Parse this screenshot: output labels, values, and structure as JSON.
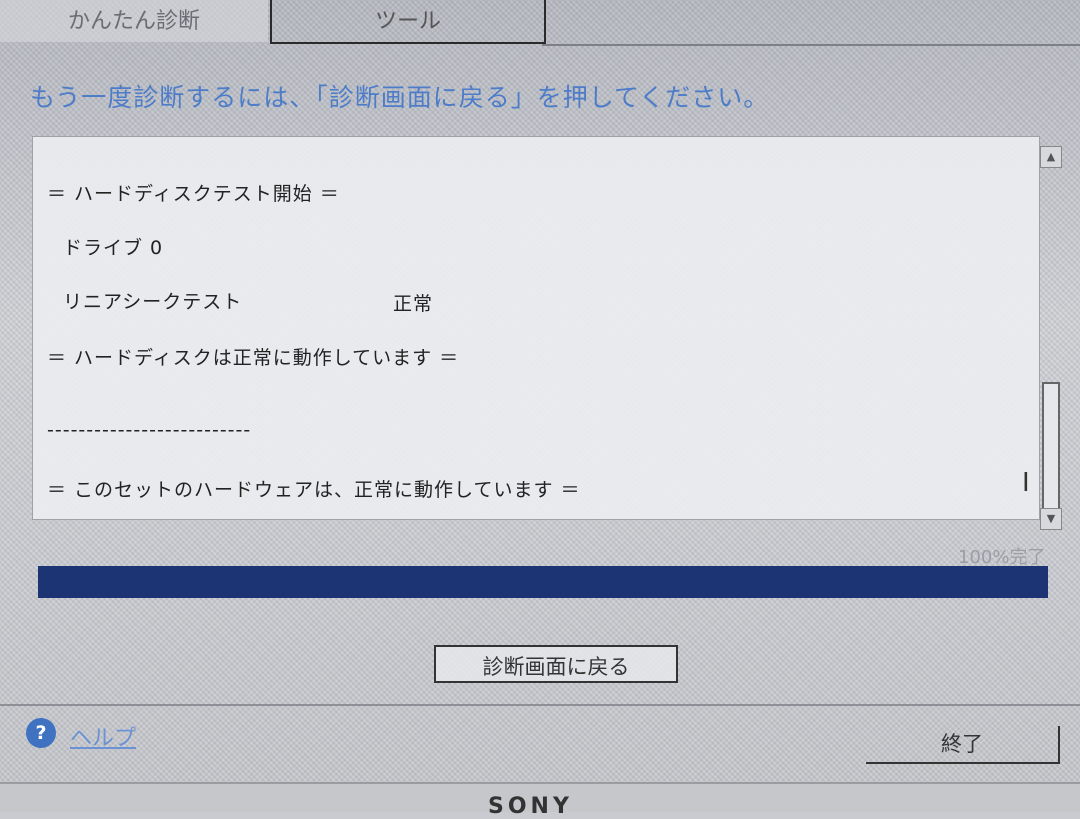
{
  "tabs": [
    {
      "label": "かんたん診断"
    },
    {
      "label": "ツール"
    }
  ],
  "instruction": "もう一度診断するには、「診断画面に戻る」を押してください。",
  "log": {
    "lines": [
      "＝ ハードディスクテスト開始 ＝",
      "ドライブ 0",
      "リニアシークテスト",
      "正常",
      "＝ ハードディスクは正常に動作しています ＝",
      "--------------------------",
      "＝ このセットのハードウェアは、正常に動作しています ＝"
    ]
  },
  "progress": {
    "label": "100%完了",
    "percent": 100,
    "color": "#1c3374"
  },
  "buttons": {
    "back": "診断画面に戻る",
    "exit": "終了"
  },
  "help": {
    "icon": "question-mark-icon",
    "icon_glyph": "?",
    "label": "ヘルプ",
    "color": "#3f73c2"
  },
  "brand": "SONY"
}
